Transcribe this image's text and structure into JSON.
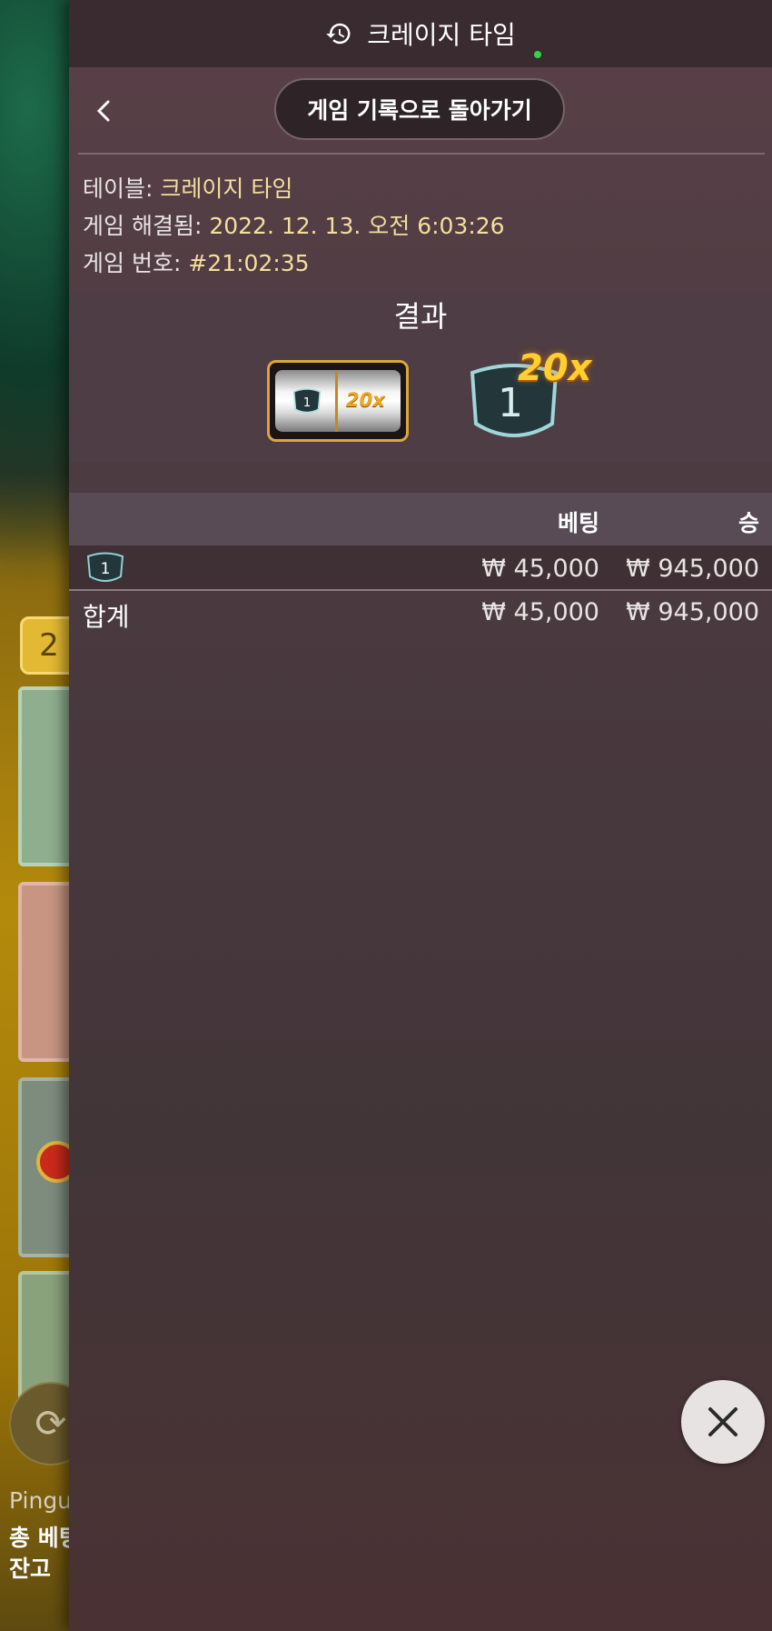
{
  "header": {
    "title": "크레이지 타임"
  },
  "nav": {
    "return_label": "게임 기록으로 돌아가기"
  },
  "info": {
    "table_label": "테이블:",
    "table_value": "크레이지 타임",
    "resolved_label": "게임 해결됨:",
    "resolved_value": "2022. 12. 13. 오전 6:03:26",
    "number_label": "게임 번호:",
    "number_value": "#21:02:35"
  },
  "result": {
    "title": "결과",
    "slot_segment": "1",
    "slot_multiplier": "20x",
    "segment": "1",
    "multiplier": "20x"
  },
  "bets": {
    "columns": {
      "bet": "베팅",
      "win": "승"
    },
    "rows": [
      {
        "spot": "1",
        "bet": "₩ 45,000",
        "win": "₩ 945,000"
      }
    ],
    "total": {
      "label": "합계",
      "bet": "₩ 45,000",
      "win": "₩ 945,000"
    }
  },
  "background": {
    "chip_value": "2",
    "player": "Pingu",
    "total_bet_label": "총 베팅",
    "balance_label": "잔고"
  },
  "icons": [
    "history-icon",
    "back-chevron-icon",
    "shield-icon",
    "close-icon",
    "refresh-icon"
  ],
  "colors": {
    "accent_gold": "#f5df9c",
    "live": "#35d14a",
    "panel": "#4a3a40"
  }
}
